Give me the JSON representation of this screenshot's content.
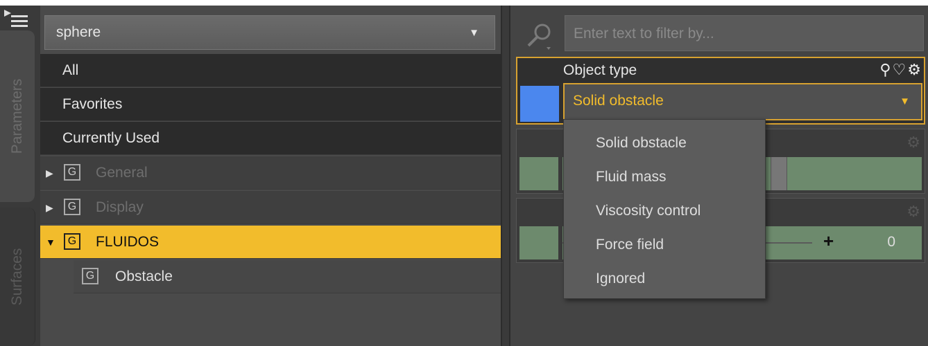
{
  "vertical_tabs": {
    "parameters": "Parameters",
    "surfaces": "Surfaces"
  },
  "left_panel": {
    "node_select": {
      "value": "sphere"
    },
    "filters": [
      "All",
      "Favorites",
      "Currently Used"
    ],
    "groups": [
      {
        "badge": "G",
        "label": "General",
        "state": "collapsed"
      },
      {
        "badge": "G",
        "label": "Display",
        "state": "collapsed"
      },
      {
        "badge": "G",
        "label": "FLUIDOS",
        "state": "expanded"
      }
    ],
    "subgroups": [
      {
        "badge": "G",
        "label": "Obstacle"
      }
    ]
  },
  "right_panel": {
    "filter": {
      "placeholder": "Enter text to filter by..."
    },
    "property": {
      "title": "Object type",
      "value": "Solid obstacle",
      "swatch_color": "#4b87ee",
      "icons": [
        "link-icon",
        "heart-icon",
        "gear-icon"
      ]
    },
    "slider_value": "0",
    "menu_items": [
      "Solid obstacle",
      "Fluid mass",
      "Viscosity control",
      "Force field",
      "Ignored"
    ]
  },
  "colors": {
    "accent": "#f2bc2c",
    "highlight_border": "#d8a230"
  }
}
